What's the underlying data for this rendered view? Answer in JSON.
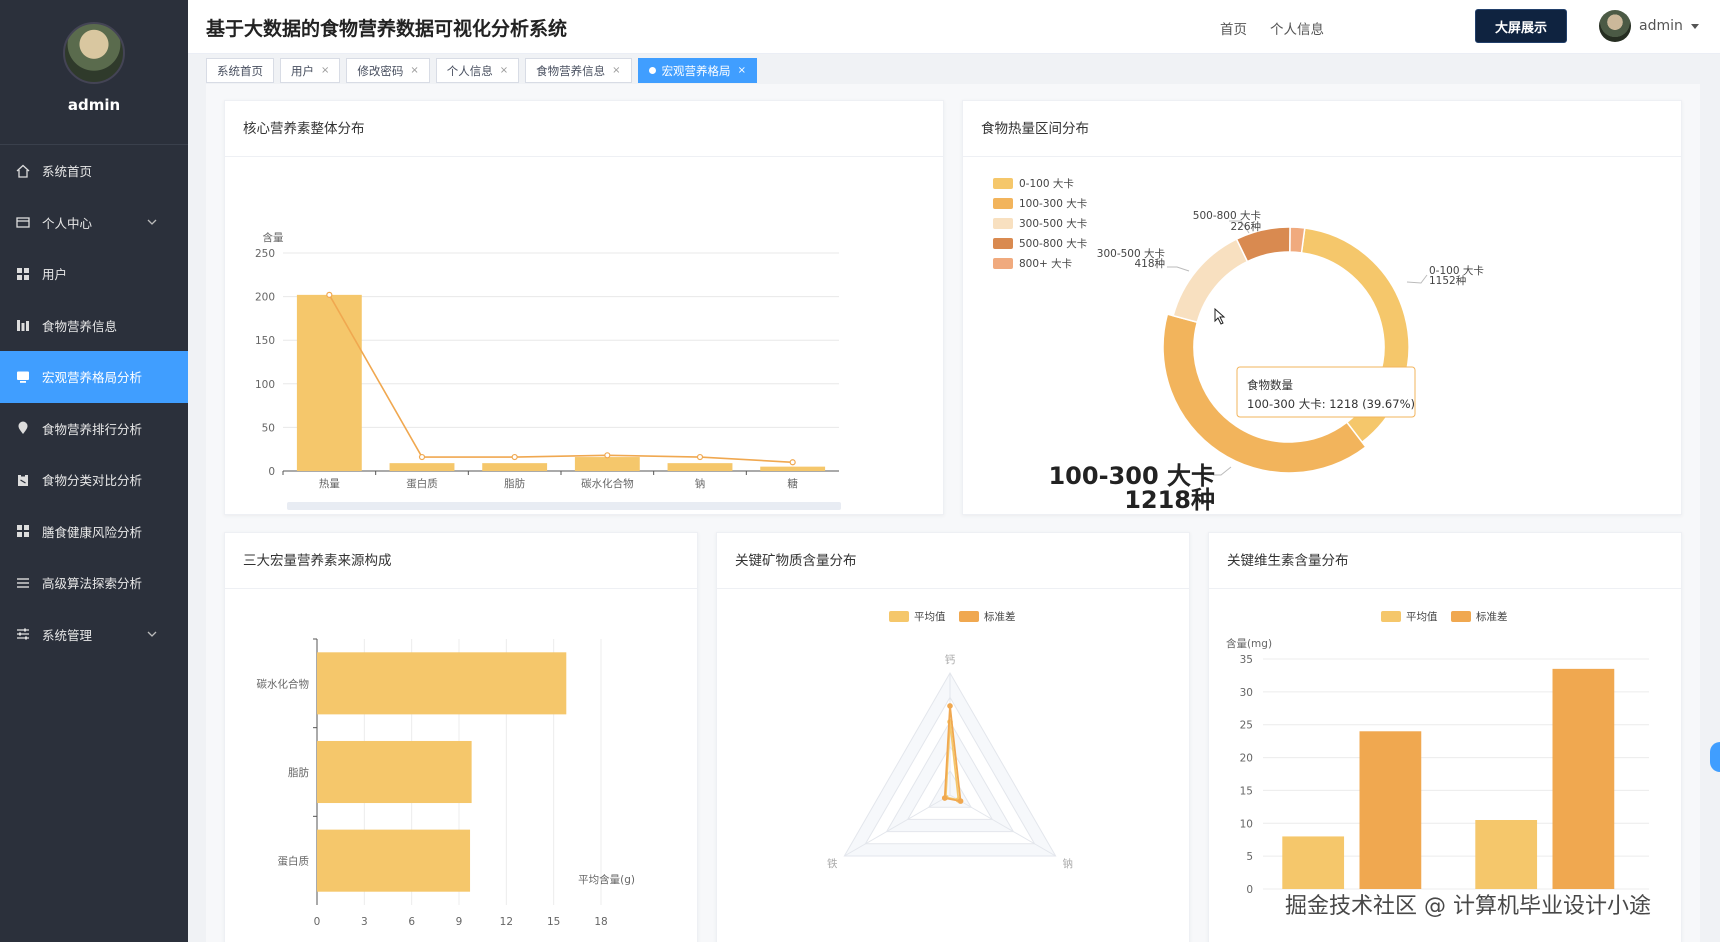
{
  "app": {
    "title": "基于大数据的食物营养数据可视化分析系统"
  },
  "sidebar": {
    "username": "admin",
    "items": [
      {
        "label": "系统首页",
        "icon": "home-icon"
      },
      {
        "label": "个人中心",
        "icon": "card-icon"
      },
      {
        "label": "用户",
        "icon": "grid-icon"
      },
      {
        "label": "食物营养信息",
        "icon": "bar-icon"
      },
      {
        "label": "宏观营养格局分析",
        "icon": "monitor-icon"
      },
      {
        "label": "食物营养排行分析",
        "icon": "pin-icon"
      },
      {
        "label": "食物分类对比分析",
        "icon": "clipboard-icon"
      },
      {
        "label": "膳食健康风险分析",
        "icon": "grid-icon"
      },
      {
        "label": "高级算法探索分析",
        "icon": "list-icon"
      },
      {
        "label": "系统管理",
        "icon": "sliders-icon"
      }
    ]
  },
  "header": {
    "nav_home": "首页",
    "nav_profile": "个人信息",
    "big_screen": "大屏展示",
    "user": "admin"
  },
  "tabs": [
    {
      "label": "系统首页",
      "closable": false
    },
    {
      "label": "用户",
      "closable": true
    },
    {
      "label": "修改密码",
      "closable": true
    },
    {
      "label": "个人信息",
      "closable": true
    },
    {
      "label": "食物营养信息",
      "closable": true
    },
    {
      "label": "宏观营养格局",
      "closable": true,
      "active": true
    }
  ],
  "cards": {
    "core": "核心营养素整体分布",
    "calorie": "食物热量区间分布",
    "macro": "三大宏量营养素来源构成",
    "mineral": "关键矿物质含量分布",
    "vitamin": "关键维生素含量分布"
  },
  "colors": {
    "accent": "#409eff",
    "bar": "#f5c76b",
    "bar2": "#f0a850",
    "sidebar": "#2b303b"
  },
  "chart_data": [
    {
      "id": "core",
      "type": "bar",
      "ylabel": "含量",
      "ylim": [
        0,
        250
      ],
      "yticks": [
        0,
        50,
        100,
        150,
        200,
        250
      ],
      "categories": [
        "热量",
        "蛋白质",
        "脂肪",
        "碳水化合物",
        "钠",
        "糖"
      ],
      "values": [
        202,
        9,
        9,
        16,
        9,
        5
      ],
      "line": [
        202,
        16,
        16,
        18,
        16,
        10
      ]
    },
    {
      "id": "calorie",
      "type": "pie",
      "series_name": "食物数量",
      "slices": [
        {
          "label": "0-100 大卡",
          "value": 1152,
          "color": "#f5c76b"
        },
        {
          "label": "100-300 大卡",
          "value": 1218,
          "color": "#f2b45c"
        },
        {
          "label": "300-500 大卡",
          "value": 418,
          "color": "#f8e0c0"
        },
        {
          "label": "500-800 大卡",
          "value": 226,
          "color": "#d98a50"
        },
        {
          "label": "800+ 大卡",
          "value": 60,
          "color": "#f0aa7e"
        }
      ],
      "callouts": {
        "s0": "0-100 大卡",
        "c0": "1152种",
        "s2": "300-500 大卡",
        "c2": "418种",
        "s3": "500-800 大卡",
        "c3": "226种"
      },
      "emphasis": {
        "label": "100-300 大卡",
        "count": "1218种"
      },
      "tooltip": {
        "title": "食物数量",
        "text": "100-300 大卡: 1218 (39.67%)"
      }
    },
    {
      "id": "macro",
      "type": "bar",
      "orientation": "horizontal",
      "xlabel": "平均含量(g)",
      "xlim": [
        0,
        18
      ],
      "xticks": [
        0,
        3,
        6,
        9,
        12,
        15,
        18
      ],
      "categories": [
        "蛋白质",
        "脂肪",
        "碳水化合物"
      ],
      "values": [
        9.7,
        9.8,
        15.8
      ]
    },
    {
      "id": "mineral",
      "type": "radar",
      "legend": [
        "平均值",
        "标准差"
      ],
      "indicators": [
        "钙",
        "钠",
        "铁"
      ],
      "max": 1,
      "series": [
        {
          "name": "平均值",
          "values": [
            0.6,
            0.08,
            0.04
          ]
        },
        {
          "name": "标准差",
          "values": [
            0.73,
            0.1,
            0.05
          ]
        }
      ]
    },
    {
      "id": "vitamin",
      "type": "bar",
      "legend": [
        "平均值",
        "标准差"
      ],
      "ylabel": "含量(mg)",
      "ylim": [
        0,
        35
      ],
      "yticks": [
        0,
        5,
        10,
        15,
        20,
        25,
        30,
        35
      ],
      "series": [
        {
          "name": "平均值",
          "values": [
            8,
            10.5
          ]
        },
        {
          "name": "标准差",
          "values": [
            24,
            33.5
          ]
        }
      ]
    }
  ],
  "watermark": "掘金技术社区 @ 计算机毕业设计小途"
}
